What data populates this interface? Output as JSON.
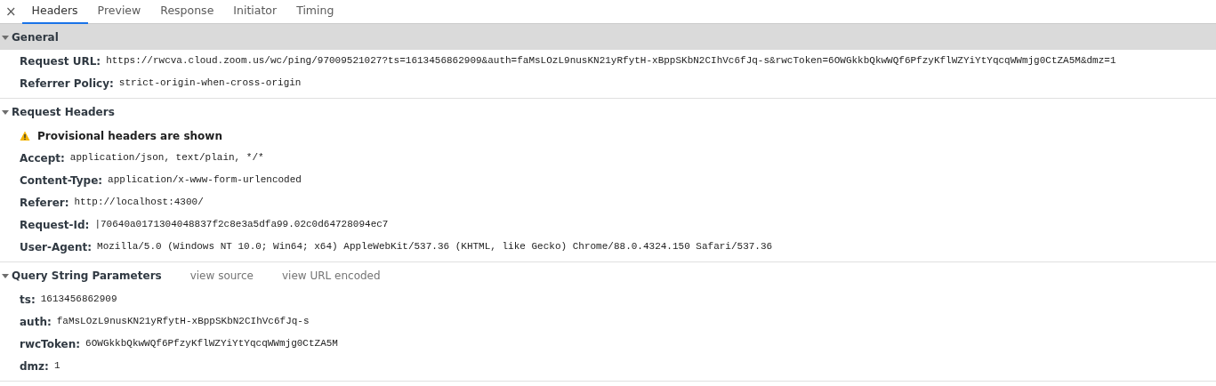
{
  "close_button": "×",
  "tabs": [
    {
      "label": "Headers",
      "selected": true
    },
    {
      "label": "Preview",
      "selected": false
    },
    {
      "label": "Response",
      "selected": false
    },
    {
      "label": "Initiator",
      "selected": false
    },
    {
      "label": "Timing",
      "selected": false
    }
  ],
  "sections": [
    {
      "title": "General",
      "expanded": true,
      "selected": true,
      "rows": [
        {
          "kind": "header",
          "name": "Request URL:",
          "value": "https://rwcva.cloud.zoom.us/wc/ping/97009521027?ts=1613456862909&auth=faMsLOzL9nusKN21yRfytH-xBppSKbN2CIhVc6fJq-s&rwcToken=6OWGkkbQkwWQf6PfzyKflWZYiYtYqcqWWmjg0CtZA5M&dmz=1"
        },
        {
          "kind": "header",
          "name": "Referrer Policy:",
          "value": "strict-origin-when-cross-origin"
        }
      ]
    },
    {
      "title": "Request Headers",
      "expanded": true,
      "selected": false,
      "rows": [
        {
          "kind": "warning",
          "text": "Provisional headers are shown"
        },
        {
          "kind": "header",
          "name": "Accept:",
          "value": "application/json, text/plain, */*"
        },
        {
          "kind": "header",
          "name": "Content-Type:",
          "value": "application/x-www-form-urlencoded"
        },
        {
          "kind": "header",
          "name": "Referer:",
          "value": "http://localhost:4300/"
        },
        {
          "kind": "header",
          "name": "Request-Id:",
          "value": "|70640a0171304048837f2c8e3a5dfa99.02c0d64728094ec7"
        },
        {
          "kind": "header",
          "name": "User-Agent:",
          "value": "Mozilla/5.0 (Windows NT 10.0; Win64; x64) AppleWebKit/537.36 (KHTML, like Gecko) Chrome/88.0.4324.150 Safari/537.36"
        }
      ]
    },
    {
      "title": "Query String Parameters",
      "expanded": true,
      "selected": false,
      "links": [
        "view source",
        "view URL encoded"
      ],
      "rows": [
        {
          "kind": "header",
          "name": "ts:",
          "value": "1613456862909"
        },
        {
          "kind": "header",
          "name": "auth:",
          "value": "faMsLOzL9nusKN21yRfytH-xBppSKbN2CIhVc6fJq-s"
        },
        {
          "kind": "header",
          "name": "rwcToken:",
          "value": "6OWGkkbQkwWQf6PfzyKflWZYiYtYqcqWWmjg0CtZA5M"
        },
        {
          "kind": "header",
          "name": "dmz:",
          "value": "1"
        }
      ]
    }
  ]
}
